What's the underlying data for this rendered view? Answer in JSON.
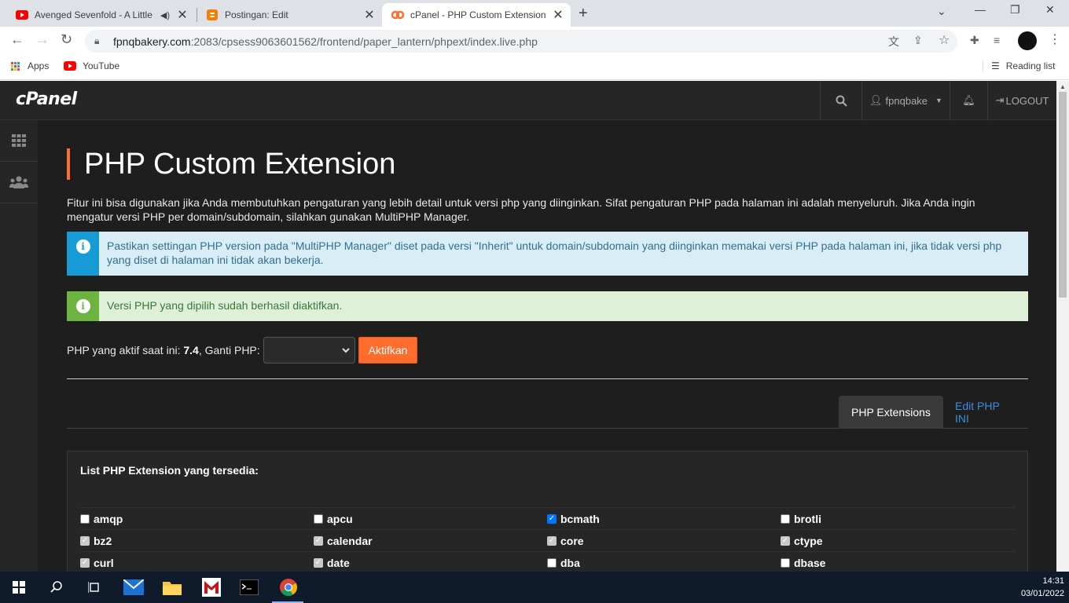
{
  "browser": {
    "tabs": [
      {
        "title": "Avenged Sevenfold - A Little",
        "icon": "youtube-icon",
        "audio": true
      },
      {
        "title": "Postingan: Edit",
        "icon": "blogger-icon"
      },
      {
        "title": "cPanel - PHP Custom Extension",
        "icon": "cpanel-icon",
        "active": true
      }
    ],
    "url_host": "fpnqbakery.com",
    "url_path": ":2083/cpsess9063601562/frontend/paper_lantern/phpext/index.live.php",
    "bookmarks": {
      "apps": "Apps",
      "youtube": "YouTube",
      "reading_list": "Reading list"
    }
  },
  "cpanel": {
    "logo": "cPanel",
    "user": "fpnqbake",
    "logout": "LOGOUT",
    "page_title": "PHP Custom Extension",
    "description": "Fitur ini bisa digunakan jika Anda membutuhkan pengaturan yang lebih detail untuk versi php yang diinginkan. Sifat pengaturan PHP pada halaman ini adalah menyeluruh. Jika Anda ingin mengatur versi PHP per domain/subdomain, silahkan gunakan MultiPHP Manager.",
    "info_alert": "Pastikan settingan PHP version pada \"MultiPHP Manager\" diset pada versi \"Inherit\" untuk domain/subdomain yang diinginkan memakai versi PHP pada halaman ini, jika tidak versi php yang diset di halaman ini tidak akan bekerja.",
    "success_alert": "Versi PHP yang dipilih sudah berhasil diaktifkan.",
    "php_active_label": "PHP yang aktif saat ini:",
    "php_version": "7.4",
    "php_change_label": ", Ganti PHP:",
    "select_value": "",
    "activate_button": "Aktifkan",
    "tab_extensions": "PHP Extensions",
    "tab_edit_ini": "Edit PHP INI",
    "list_title": "List PHP Extension yang tersedia:",
    "extensions": [
      [
        {
          "name": "amqp",
          "state": "unchecked"
        },
        {
          "name": "apcu",
          "state": "unchecked"
        },
        {
          "name": "bcmath",
          "state": "checked"
        },
        {
          "name": "brotli",
          "state": "unchecked"
        }
      ],
      [
        {
          "name": "bz2",
          "state": "disabled"
        },
        {
          "name": "calendar",
          "state": "disabled"
        },
        {
          "name": "core",
          "state": "disabled"
        },
        {
          "name": "ctype",
          "state": "disabled"
        }
      ],
      [
        {
          "name": "curl",
          "state": "disabled"
        },
        {
          "name": "date",
          "state": "disabled"
        },
        {
          "name": "dba",
          "state": "unchecked"
        },
        {
          "name": "dbase",
          "state": "unchecked"
        }
      ]
    ]
  },
  "taskbar": {
    "time": "14:31",
    "date": "03/01/2022"
  }
}
